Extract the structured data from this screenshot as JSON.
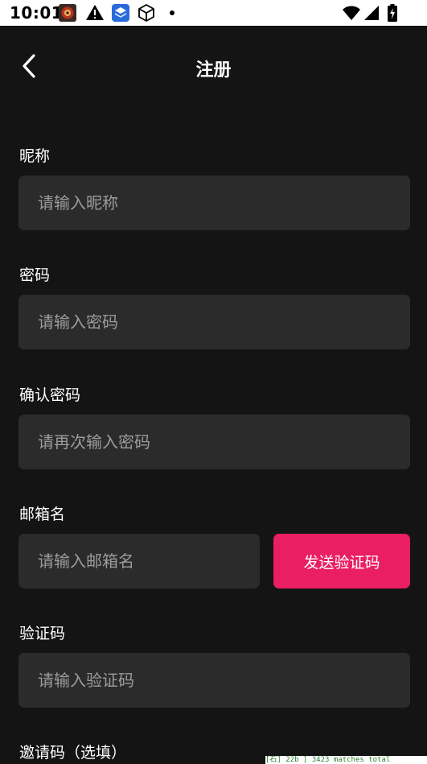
{
  "status_bar": {
    "time": "10:01",
    "icons": [
      "app-notification-icon",
      "warning-icon",
      "app-icon",
      "box-icon",
      "dot-icon",
      "wifi-icon",
      "signal-icon",
      "battery-charging-icon"
    ]
  },
  "header": {
    "title": "注册",
    "back_icon": "chevron-left-icon"
  },
  "form": {
    "nickname": {
      "label": "昵称",
      "placeholder": "请输入昵称"
    },
    "password": {
      "label": "密码",
      "placeholder": "请输入密码"
    },
    "confirm_password": {
      "label": "确认密码",
      "placeholder": "请再次输入密码"
    },
    "email": {
      "label": "邮箱名",
      "placeholder": "请输入邮箱名"
    },
    "send_code_label": "发送验证码",
    "verification_code": {
      "label": "验证码",
      "placeholder": "请输入验证码"
    },
    "invite_code": {
      "label": "邀请码（选填）"
    }
  },
  "debug_overlay": {
    "text": "[石] 22b ] 3423 matches total"
  },
  "colors": {
    "background": "#141414",
    "input_background": "#2b2b2b",
    "accent": "#e91e63",
    "placeholder": "#9c9c9c"
  }
}
